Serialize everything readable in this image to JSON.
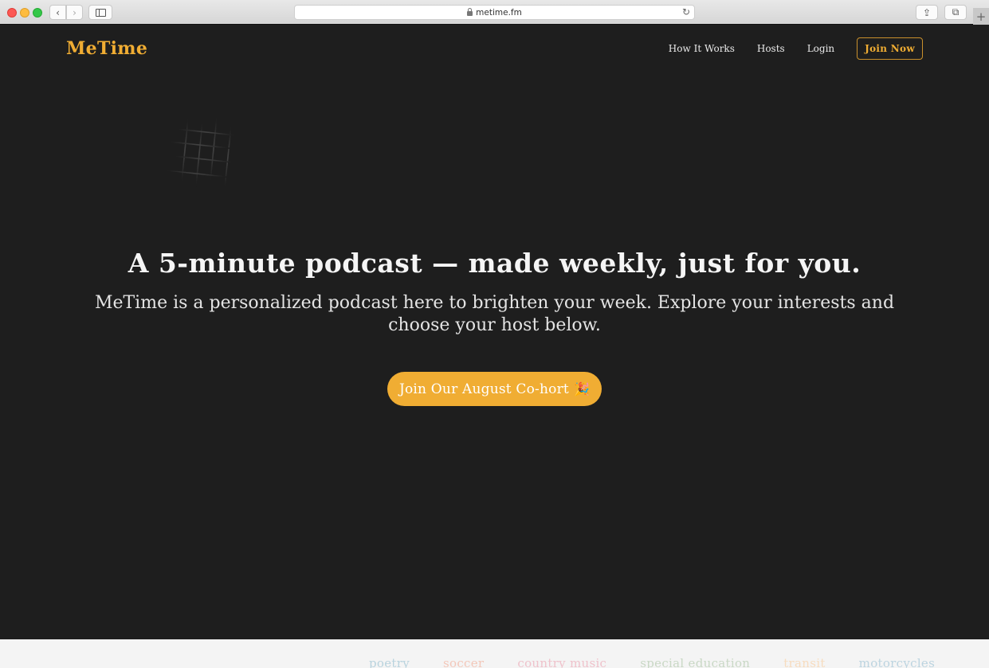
{
  "browser": {
    "url": "metime.fm",
    "back_icon": "chevron-left-icon",
    "forward_icon": "chevron-right-icon",
    "back_glyph": "‹",
    "forward_glyph": "›",
    "reload_glyph": "↻",
    "share_glyph": "⇪",
    "tabs_glyph": "⧉",
    "newtab_glyph": "+"
  },
  "header": {
    "logo": "MeTime",
    "nav": [
      {
        "label": "How It Works"
      },
      {
        "label": "Hosts"
      },
      {
        "label": "Login"
      }
    ],
    "cta_label": "Join Now"
  },
  "hero": {
    "title": "A 5-minute podcast — made weekly, just for you.",
    "subtitle": "MeTime is a personalized podcast here to brighten your week. Explore your interests and choose your host below.",
    "cta_label": "Join Our August Co-hort",
    "cta_emoji": "🎉"
  },
  "topics": [
    {
      "label": "poetry",
      "color": "#b9d3de"
    },
    {
      "label": "soccer",
      "color": "#f3c7b9"
    },
    {
      "label": "country music",
      "color": "#efc2cb"
    },
    {
      "label": "special education",
      "color": "#c9d8c5"
    },
    {
      "label": "transit",
      "color": "#f7dcbf"
    },
    {
      "label": "motorcycles",
      "color": "#bcd4e0"
    }
  ],
  "colors": {
    "brand": "#f0ad33",
    "background": "#1e1e1e",
    "band": "#f4f4f4"
  }
}
